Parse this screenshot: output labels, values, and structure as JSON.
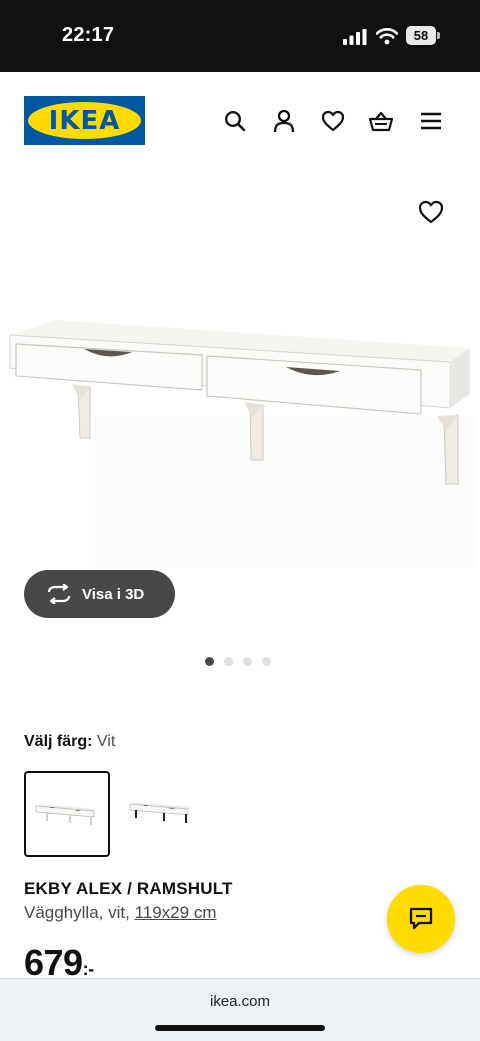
{
  "status_bar": {
    "time": "22:17",
    "battery": "58"
  },
  "header": {
    "logo_text": "IKEA",
    "icons": [
      "search-icon",
      "user-icon",
      "heart-icon",
      "basket-icon",
      "menu-icon"
    ]
  },
  "gallery": {
    "view_3d_label": "Visa i 3D",
    "dot_count": 4,
    "active_dot": 1
  },
  "color_select": {
    "label": "Välj färg:",
    "value": "Vit",
    "options_count": 2,
    "selected_index": 0
  },
  "product": {
    "name": "EKBY ALEX / RAMSHULT",
    "description": "Vägghylla, vit,",
    "size": "119x29 cm",
    "price": "679",
    "price_suffix": ":-"
  },
  "browser": {
    "url": "ikea.com"
  },
  "colors": {
    "brand_blue": "#0058a3",
    "brand_yellow": "#ffdb00",
    "dark_button": "#484848"
  }
}
